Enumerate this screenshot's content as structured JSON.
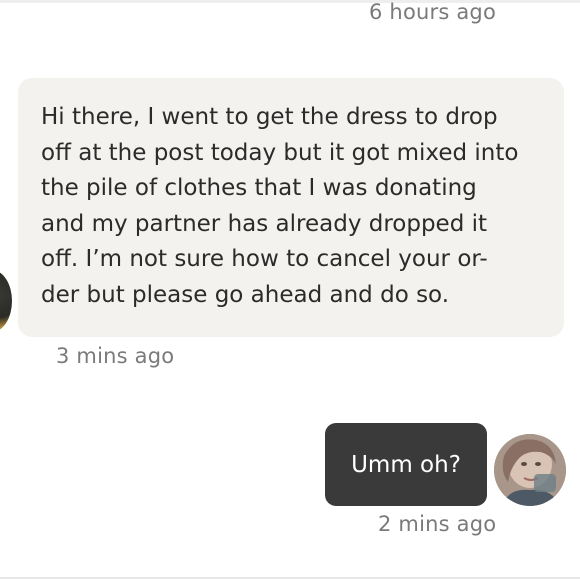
{
  "conversation": {
    "top_timestamp": "6 hours ago",
    "incoming_message": {
      "lines": [
        "Hi there, I went to get the dress to drop",
        "off at the post today but it got mixed into",
        "the pile of clothes that I was donating",
        "and my partner has already dropped it",
        "off. I’m not sure how to cancel your or-",
        "der but please go ahead and do so."
      ],
      "timestamp": "3 mins ago",
      "sender_avatar_icon": "user-avatar-icon"
    },
    "outgoing_message": {
      "text": "Umm oh?",
      "timestamp": "2 mins ago",
      "sender_avatar_icon": "user-avatar-icon"
    }
  },
  "colors": {
    "incoming_bubble_bg": "#f4f2ee",
    "outgoing_bubble_bg": "#3a3a3a",
    "timestamp_text": "#7a7a7a",
    "message_text": "#2b2b2b"
  }
}
